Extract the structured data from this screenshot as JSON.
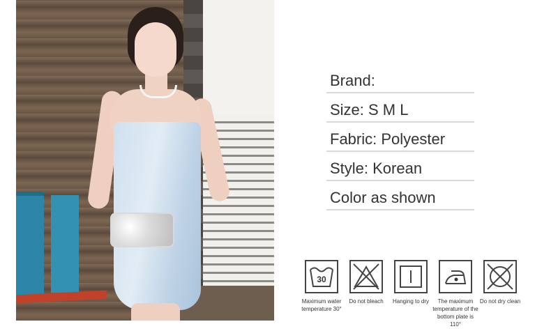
{
  "specs": {
    "brand": "Brand:",
    "size": "Size: S M L",
    "fabric": "Fabric: Polyester",
    "style": "Style: Korean",
    "color": "Color as shown"
  },
  "care": [
    {
      "icon": "wash-30-icon",
      "label": "Maximum water temperature 30°",
      "number": "30"
    },
    {
      "icon": "do-not-bleach-icon",
      "label": "Do not bleach"
    },
    {
      "icon": "hang-to-dry-icon",
      "label": "Hanging to dry"
    },
    {
      "icon": "iron-low-heat-icon",
      "label": "The maximum temperature of the bottom plate is 110°"
    },
    {
      "icon": "do-not-dry-clean-icon",
      "label": "Do not dry clean"
    }
  ]
}
